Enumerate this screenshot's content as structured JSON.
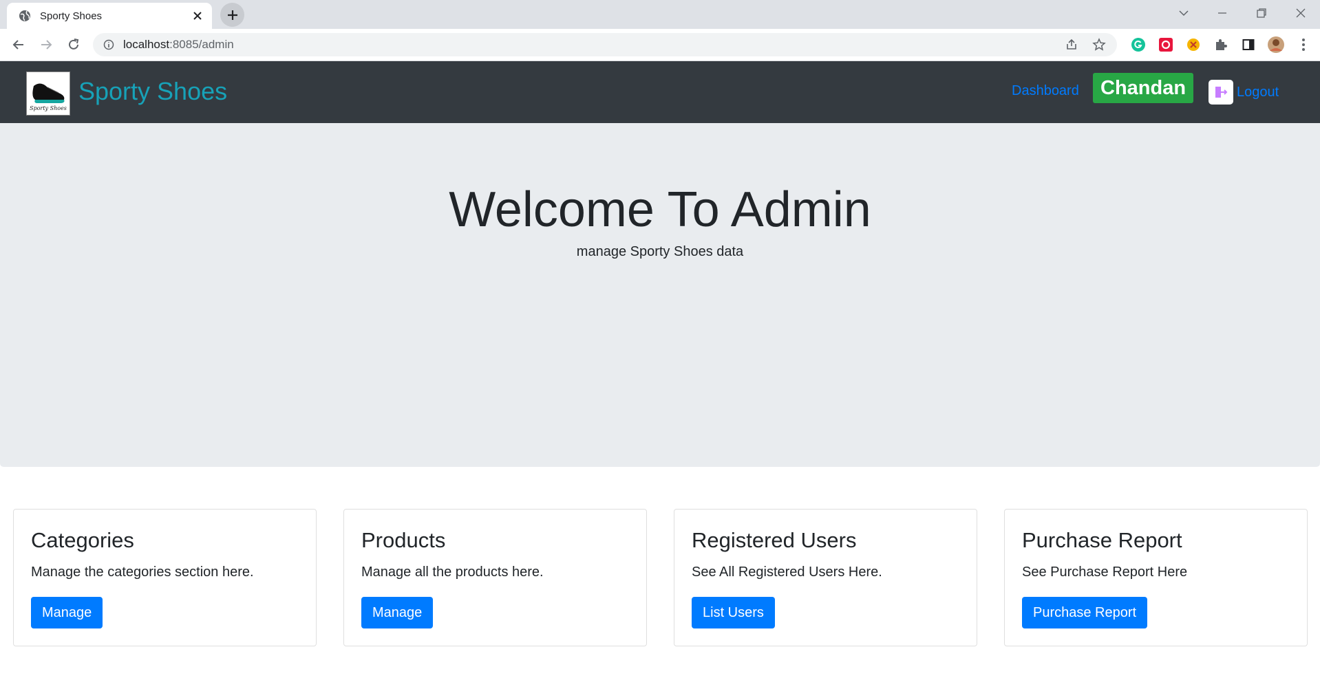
{
  "browser": {
    "tab_title": "Sporty Shoes",
    "url_host": "localhost",
    "url_path": ":8085/admin"
  },
  "navbar": {
    "brand": "Sporty Shoes",
    "logo_caption": "Sporty Shoes",
    "dashboard_link": "Dashboard",
    "user_badge": "Chandan",
    "logout_link": "Logout"
  },
  "jumbotron": {
    "title": "Welcome To Admin",
    "subtitle": "manage Sporty Shoes data"
  },
  "cards": [
    {
      "title": "Categories",
      "text": "Manage the categories section here.",
      "button": "Manage"
    },
    {
      "title": "Products",
      "text": "Manage all the products here.",
      "button": "Manage"
    },
    {
      "title": "Registered Users",
      "text": "See All Registered Users Here.",
      "button": "List Users"
    },
    {
      "title": "Purchase Report",
      "text": "See Purchase Report Here",
      "button": "Purchase Report"
    }
  ],
  "colors": {
    "navbar_bg": "#343a40",
    "brand": "#17a2b8",
    "link": "#007bff",
    "user_badge_bg": "#28a745",
    "jumbotron_bg": "#e9ecef",
    "button_bg": "#007bff"
  },
  "icons": {
    "tab": "globe-icon",
    "omnibox": [
      "info-icon",
      "share-icon",
      "star-icon"
    ],
    "extensions": [
      "grammarly-icon",
      "extension-red-icon",
      "extension-orange-icon",
      "puzzle-icon",
      "side-panel-icon",
      "profile-avatar",
      "kebab-menu-icon"
    ]
  }
}
